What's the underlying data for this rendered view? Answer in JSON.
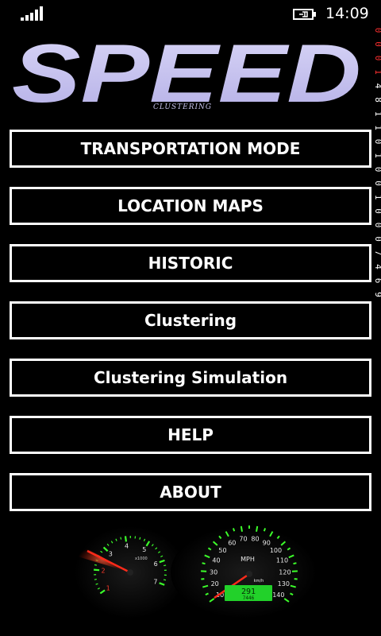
{
  "status_bar": {
    "signal_icon": "signal-strength-icon",
    "battery_icon": "battery-charging-icon",
    "time": "14:09"
  },
  "logo": {
    "title": "SPEED",
    "subtitle": "CLUSTERING",
    "color": "#c8c4f0"
  },
  "menu": {
    "items": [
      {
        "label": "TRANSPORTATION MODE"
      },
      {
        "label": "LOCATION MAPS"
      },
      {
        "label": "HISTORIC"
      },
      {
        "label": "Clustering"
      },
      {
        "label": "Clustering Simulation"
      },
      {
        "label": "HELP"
      },
      {
        "label": "ABOUT"
      }
    ]
  },
  "side_counter": {
    "digits": [
      "0",
      "0",
      "0",
      "1",
      "4",
      "8",
      "1",
      "1",
      "0",
      "1",
      "0",
      "0",
      "1",
      "0",
      "0",
      "0",
      "7",
      "4",
      "6",
      "9"
    ]
  },
  "dashboard": {
    "tachometer_labels": [
      "1",
      "2",
      "3",
      "4",
      "5",
      "6",
      "7"
    ],
    "tachometer_unit": "x1000",
    "speedometer_labels": [
      "10",
      "20",
      "30",
      "40",
      "50",
      "60",
      "70",
      "80",
      "90",
      "100",
      "110",
      "120",
      "130",
      "140"
    ],
    "speed_unit": "MPH",
    "speed_unit_inner": "km/h",
    "odometer": "291",
    "trip": "7446"
  },
  "colors": {
    "background": "#000000",
    "button_border": "#ffffff",
    "gauge_green": "#3cff2a",
    "needle_red": "#ff2a1a",
    "odometer_green": "#22d12a"
  }
}
